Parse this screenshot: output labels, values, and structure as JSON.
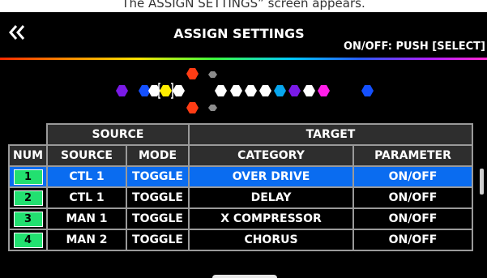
{
  "caption": "The ASSIGN SETTINGS” screen appears.",
  "screen": {
    "title": "ASSIGN SETTINGS",
    "hint": "ON/OFF: PUSH [SELECT]",
    "back_icon": "double-chevron-left-icon"
  },
  "effect_chain": {
    "colors": {
      "purple": "#7a1ae6",
      "blue": "#1450ff",
      "yellow": "#ffee00",
      "white": "#ffffff",
      "cyan": "#08a6ee",
      "magenta": "#ff1ee8",
      "orange": "#ff3c14",
      "gray": "#8c8c8c"
    }
  },
  "table": {
    "group_headers": {
      "source": "SOURCE",
      "target": "TARGET"
    },
    "columns": {
      "num": "NUM",
      "source": "SOURCE",
      "mode": "MODE",
      "category": "CATEGORY",
      "parameter": "PARAMETER"
    },
    "rows": [
      {
        "num": "1",
        "source": "CTL 1",
        "mode": "TOGGLE",
        "category": "OVER DRIVE",
        "parameter": "ON/OFF",
        "selected": true
      },
      {
        "num": "2",
        "source": "CTL 1",
        "mode": "TOGGLE",
        "category": "DELAY",
        "parameter": "ON/OFF",
        "selected": false
      },
      {
        "num": "3",
        "source": "MAN 1",
        "mode": "TOGGLE",
        "category": "X COMPRESSOR",
        "parameter": "ON/OFF",
        "selected": false
      },
      {
        "num": "4",
        "source": "MAN 2",
        "mode": "TOGGLE",
        "category": "CHORUS",
        "parameter": "ON/OFF",
        "selected": false
      }
    ],
    "colors": {
      "selected_row": "#0a6cf0",
      "num_badge": "#22e070",
      "header_bg": "#2e2e2e"
    }
  }
}
